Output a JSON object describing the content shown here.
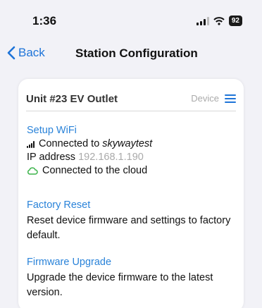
{
  "status_bar": {
    "time": "1:36",
    "battery": "92"
  },
  "nav": {
    "back_label": "Back",
    "title": "Station Configuration"
  },
  "card": {
    "title": "Unit #23 EV Outlet",
    "device_label": "Device",
    "wifi": {
      "link": "Setup WiFi",
      "connected_prefix": "Connected to ",
      "ssid": "skywaytest",
      "ip_label": "IP address",
      "ip_value": "192.168.1.190",
      "cloud_status": "Connected to the cloud"
    },
    "factory_reset": {
      "link": "Factory Reset",
      "description": "Reset device firmware and settings to factory default."
    },
    "firmware_upgrade": {
      "link": "Firmware Upgrade",
      "description": "Upgrade the device firmware to the latest version."
    }
  },
  "colors": {
    "accent": "#1e74d8",
    "link": "#2a83d9",
    "cloud_icon": "#3bb34a",
    "background": "#f2f2f7"
  }
}
